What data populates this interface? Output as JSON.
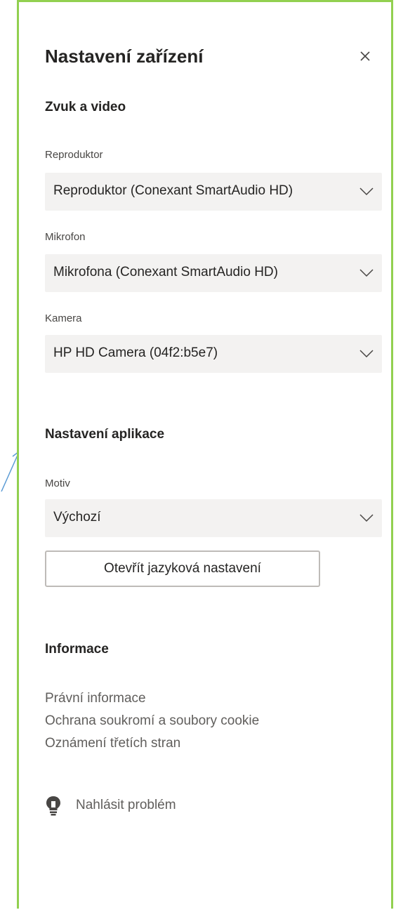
{
  "title": "Nastavení zařízení",
  "sections": {
    "av": "Zvuk a video",
    "app": "Nastavení aplikace",
    "info": "Informace"
  },
  "speaker": {
    "label": "Reproduktor",
    "value": "Reproduktor (Conexant SmartAudio HD)"
  },
  "mic": {
    "label": "Mikrofon",
    "value": "Mikrofona (Conexant SmartAudio HD)"
  },
  "camera": {
    "label": "Kamera",
    "value": "HP HD Camera (04f2:b5e7)"
  },
  "theme": {
    "label": "Motiv",
    "value": "Výchozí"
  },
  "language_button": "Otevřít jazyková nastavení",
  "info_links": [
    "Právní informace",
    "Ochrana soukromí a soubory cookie",
    "Oznámení třetích stran"
  ],
  "report_problem": "Nahlásit problém",
  "colors": {
    "highlight_border": "#92d050",
    "annotation_arrow": "#5b9bd5"
  },
  "icons": {
    "close": "close-icon",
    "dropdown": "chevron-down-icon",
    "report": "lightbulb-icon"
  }
}
